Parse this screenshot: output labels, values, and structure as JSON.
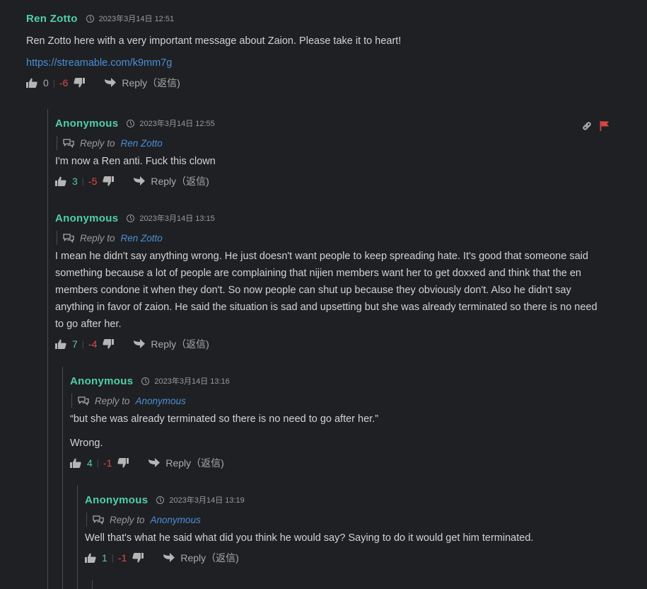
{
  "comments": [
    {
      "author": "Ren Zotto",
      "time": "2023年3月14日 12:51",
      "text": "Ren Zotto here with a very important message about Zaion. Please take it to heart!",
      "link": "https://streamable.com/k9mm7g",
      "up": "0",
      "down": "-6",
      "reply": "Reply（返信)"
    },
    {
      "author": "Anonymous",
      "time": "2023年3月14日 12:55",
      "reply_to_label": "Reply to",
      "reply_to": "Ren Zotto",
      "text": "I'm now a Ren anti. Fuck this clown",
      "up": "3",
      "down": "-5",
      "reply": "Reply（返信)"
    },
    {
      "author": "Anonymous",
      "time": "2023年3月14日 13:15",
      "reply_to_label": "Reply to",
      "reply_to": "Ren Zotto",
      "text": "I mean he didn't say anything wrong. He just doesn't want people to keep spreading hate. It's good that someone said something because a lot of people are complaining that nijien members want her to get doxxed and think that the en members condone it when they don't. So now people can shut up because they obviously don't. Also he didn't say anything in favor of zaion. He said the situation is sad and upsetting but she was already terminated so there is no need to go after her.",
      "up": "7",
      "down": "-4",
      "reply": "Reply（返信)"
    },
    {
      "author": "Anonymous",
      "time": "2023年3月14日 13:16",
      "reply_to_label": "Reply to",
      "reply_to": "Anonymous",
      "text": "“but she was already terminated so there is no need to go after her.”",
      "text2": "Wrong.",
      "up": "4",
      "down": "-1",
      "reply": "Reply（返信)"
    },
    {
      "author": "Anonymous",
      "time": "2023年3月14日 13:19",
      "reply_to_label": "Reply to",
      "reply_to": "Anonymous",
      "text": "Well that's what he said what did you think he would say? Saying to do it would get him terminated.",
      "up": "1",
      "down": "-1",
      "reply": "Reply（返信)"
    }
  ],
  "icons": {
    "link": "link-icon",
    "flag": "flag-icon",
    "thumb_up": "thumbs-up-icon",
    "thumb_down": "thumbs-down-icon",
    "reply": "reply-arrow-icon",
    "reply_to": "chat-bubbles-icon",
    "time": "clock-icon"
  },
  "colors": {
    "background": "#1f2023",
    "author": "#4fd1a5",
    "link": "#4a8fd8",
    "upvote": "#4fd1a5",
    "downvote": "#e24a4a",
    "flag": "#d64545"
  }
}
